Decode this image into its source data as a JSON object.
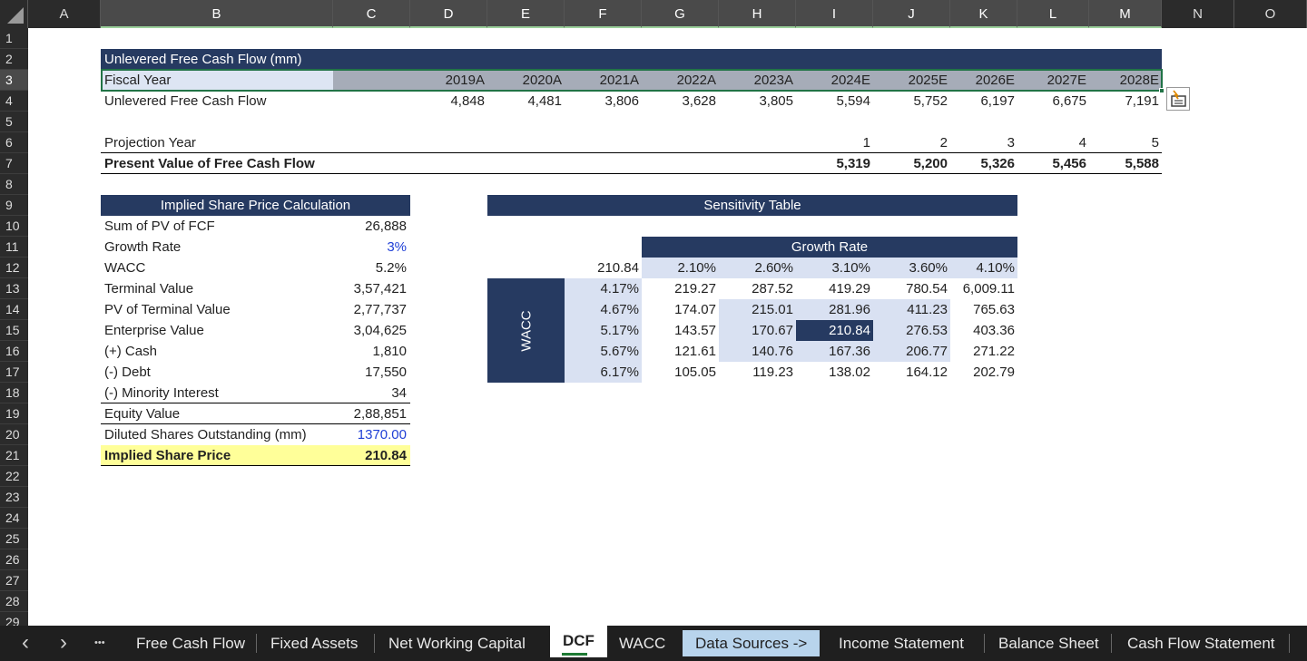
{
  "columns": [
    "A",
    "B",
    "C",
    "D",
    "E",
    "F",
    "G",
    "H",
    "I",
    "J",
    "K",
    "L",
    "M",
    "N",
    "O"
  ],
  "rows": [
    "1",
    "2",
    "3",
    "4",
    "5",
    "6",
    "7",
    "8",
    "9",
    "10",
    "11",
    "12",
    "13",
    "14",
    "15",
    "16",
    "17",
    "18",
    "19",
    "20",
    "21",
    "22",
    "23",
    "24",
    "25",
    "26",
    "27",
    "28",
    "29"
  ],
  "ufcf": {
    "title": "Unlevered Free Cash Flow (mm)",
    "fiscal_label": "Fiscal Year",
    "years": [
      "2019A",
      "2020A",
      "2021A",
      "2022A",
      "2023A",
      "2024E",
      "2025E",
      "2026E",
      "2027E",
      "2028E"
    ],
    "ufcf_label": "Unlevered Free Cash Flow",
    "ufcf_values": [
      "4,848",
      "4,481",
      "3,806",
      "3,628",
      "3,805",
      "5,594",
      "5,752",
      "6,197",
      "6,675",
      "7,191"
    ],
    "projection_label": "Projection Year",
    "projection_years": [
      "1",
      "2",
      "3",
      "4",
      "5"
    ],
    "pv_label": "Present Value of Free Cash Flow",
    "pv_values": [
      "5,319",
      "5,200",
      "5,326",
      "5,456",
      "5,588"
    ]
  },
  "implied": {
    "title": "Implied Share Price Calculation",
    "rows": [
      {
        "label": "Sum of PV of FCF",
        "value": "26,888"
      },
      {
        "label": "Growth Rate",
        "value": "3%"
      },
      {
        "label": "WACC",
        "value": "5.2%"
      },
      {
        "label": "Terminal Value",
        "value": "3,57,421"
      },
      {
        "label": "PV of Terminal Value",
        "value": "2,77,737"
      },
      {
        "label": "Enterprise Value",
        "value": "3,04,625"
      },
      {
        "label": "(+) Cash",
        "value": "1,810"
      },
      {
        "label": "(-) Debt",
        "value": "17,550"
      },
      {
        "label": "(-) Minority Interest",
        "value": "34"
      },
      {
        "label": "Equity Value",
        "value": "2,88,851"
      },
      {
        "label": "Diluted Shares Outstanding (mm)",
        "value": "1370.00"
      },
      {
        "label": "Implied Share Price",
        "value": "210.84"
      }
    ]
  },
  "sensitivity": {
    "title": "Sensitivity Table",
    "growth_label": "Growth Rate",
    "wacc_label": "WACC",
    "corner": "210.84",
    "growth_rates": [
      "2.10%",
      "2.60%",
      "3.10%",
      "3.60%",
      "4.10%"
    ],
    "wacc_rates": [
      "4.17%",
      "4.67%",
      "5.17%",
      "5.67%",
      "6.17%"
    ],
    "values": [
      [
        "219.27",
        "287.52",
        "419.29",
        "780.54",
        "6,009.11"
      ],
      [
        "174.07",
        "215.01",
        "281.96",
        "411.23",
        "765.63"
      ],
      [
        "143.57",
        "170.67",
        "210.84",
        "276.53",
        "403.36"
      ],
      [
        "121.61",
        "140.76",
        "167.36",
        "206.77",
        "271.22"
      ],
      [
        "105.05",
        "119.23",
        "138.02",
        "164.12",
        "202.79"
      ]
    ]
  },
  "tabs": {
    "prev": "‹",
    "next": "›",
    "more": "•••",
    "items": [
      "Free Cash Flow",
      "Fixed Assets",
      "Net Working Capital",
      "DCF",
      "WACC",
      "Data Sources ->",
      "Income Statement",
      "Balance Sheet",
      "Cash Flow Statement"
    ]
  },
  "colors": {
    "navy": "#263a61",
    "light_blue": "#d9e1f2",
    "highlight_yellow": "#ffff99",
    "input_blue": "#1f3fd6",
    "active_tab_underline": "#1e7b34"
  }
}
